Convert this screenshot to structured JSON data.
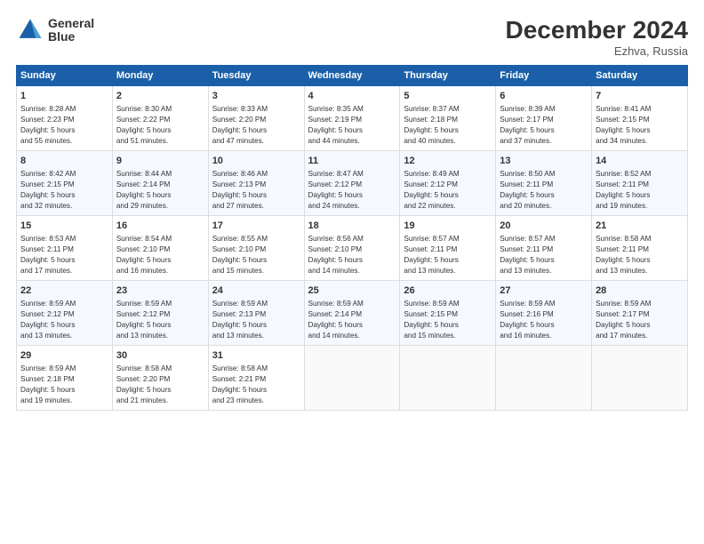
{
  "logo": {
    "line1": "General",
    "line2": "Blue"
  },
  "title": "December 2024",
  "subtitle": "Ezhva, Russia",
  "days_of_week": [
    "Sunday",
    "Monday",
    "Tuesday",
    "Wednesday",
    "Thursday",
    "Friday",
    "Saturday"
  ],
  "weeks": [
    [
      {
        "day": "1",
        "info": "Sunrise: 8:28 AM\nSunset: 2:23 PM\nDaylight: 5 hours\nand 55 minutes."
      },
      {
        "day": "2",
        "info": "Sunrise: 8:30 AM\nSunset: 2:22 PM\nDaylight: 5 hours\nand 51 minutes."
      },
      {
        "day": "3",
        "info": "Sunrise: 8:33 AM\nSunset: 2:20 PM\nDaylight: 5 hours\nand 47 minutes."
      },
      {
        "day": "4",
        "info": "Sunrise: 8:35 AM\nSunset: 2:19 PM\nDaylight: 5 hours\nand 44 minutes."
      },
      {
        "day": "5",
        "info": "Sunrise: 8:37 AM\nSunset: 2:18 PM\nDaylight: 5 hours\nand 40 minutes."
      },
      {
        "day": "6",
        "info": "Sunrise: 8:39 AM\nSunset: 2:17 PM\nDaylight: 5 hours\nand 37 minutes."
      },
      {
        "day": "7",
        "info": "Sunrise: 8:41 AM\nSunset: 2:15 PM\nDaylight: 5 hours\nand 34 minutes."
      }
    ],
    [
      {
        "day": "8",
        "info": "Sunrise: 8:42 AM\nSunset: 2:15 PM\nDaylight: 5 hours\nand 32 minutes."
      },
      {
        "day": "9",
        "info": "Sunrise: 8:44 AM\nSunset: 2:14 PM\nDaylight: 5 hours\nand 29 minutes."
      },
      {
        "day": "10",
        "info": "Sunrise: 8:46 AM\nSunset: 2:13 PM\nDaylight: 5 hours\nand 27 minutes."
      },
      {
        "day": "11",
        "info": "Sunrise: 8:47 AM\nSunset: 2:12 PM\nDaylight: 5 hours\nand 24 minutes."
      },
      {
        "day": "12",
        "info": "Sunrise: 8:49 AM\nSunset: 2:12 PM\nDaylight: 5 hours\nand 22 minutes."
      },
      {
        "day": "13",
        "info": "Sunrise: 8:50 AM\nSunset: 2:11 PM\nDaylight: 5 hours\nand 20 minutes."
      },
      {
        "day": "14",
        "info": "Sunrise: 8:52 AM\nSunset: 2:11 PM\nDaylight: 5 hours\nand 19 minutes."
      }
    ],
    [
      {
        "day": "15",
        "info": "Sunrise: 8:53 AM\nSunset: 2:11 PM\nDaylight: 5 hours\nand 17 minutes."
      },
      {
        "day": "16",
        "info": "Sunrise: 8:54 AM\nSunset: 2:10 PM\nDaylight: 5 hours\nand 16 minutes."
      },
      {
        "day": "17",
        "info": "Sunrise: 8:55 AM\nSunset: 2:10 PM\nDaylight: 5 hours\nand 15 minutes."
      },
      {
        "day": "18",
        "info": "Sunrise: 8:56 AM\nSunset: 2:10 PM\nDaylight: 5 hours\nand 14 minutes."
      },
      {
        "day": "19",
        "info": "Sunrise: 8:57 AM\nSunset: 2:11 PM\nDaylight: 5 hours\nand 13 minutes."
      },
      {
        "day": "20",
        "info": "Sunrise: 8:57 AM\nSunset: 2:11 PM\nDaylight: 5 hours\nand 13 minutes."
      },
      {
        "day": "21",
        "info": "Sunrise: 8:58 AM\nSunset: 2:11 PM\nDaylight: 5 hours\nand 13 minutes."
      }
    ],
    [
      {
        "day": "22",
        "info": "Sunrise: 8:59 AM\nSunset: 2:12 PM\nDaylight: 5 hours\nand 13 minutes."
      },
      {
        "day": "23",
        "info": "Sunrise: 8:59 AM\nSunset: 2:12 PM\nDaylight: 5 hours\nand 13 minutes."
      },
      {
        "day": "24",
        "info": "Sunrise: 8:59 AM\nSunset: 2:13 PM\nDaylight: 5 hours\nand 13 minutes."
      },
      {
        "day": "25",
        "info": "Sunrise: 8:59 AM\nSunset: 2:14 PM\nDaylight: 5 hours\nand 14 minutes."
      },
      {
        "day": "26",
        "info": "Sunrise: 8:59 AM\nSunset: 2:15 PM\nDaylight: 5 hours\nand 15 minutes."
      },
      {
        "day": "27",
        "info": "Sunrise: 8:59 AM\nSunset: 2:16 PM\nDaylight: 5 hours\nand 16 minutes."
      },
      {
        "day": "28",
        "info": "Sunrise: 8:59 AM\nSunset: 2:17 PM\nDaylight: 5 hours\nand 17 minutes."
      }
    ],
    [
      {
        "day": "29",
        "info": "Sunrise: 8:59 AM\nSunset: 2:18 PM\nDaylight: 5 hours\nand 19 minutes."
      },
      {
        "day": "30",
        "info": "Sunrise: 8:58 AM\nSunset: 2:20 PM\nDaylight: 5 hours\nand 21 minutes."
      },
      {
        "day": "31",
        "info": "Sunrise: 8:58 AM\nSunset: 2:21 PM\nDaylight: 5 hours\nand 23 minutes."
      },
      {
        "day": "",
        "info": ""
      },
      {
        "day": "",
        "info": ""
      },
      {
        "day": "",
        "info": ""
      },
      {
        "day": "",
        "info": ""
      }
    ]
  ]
}
